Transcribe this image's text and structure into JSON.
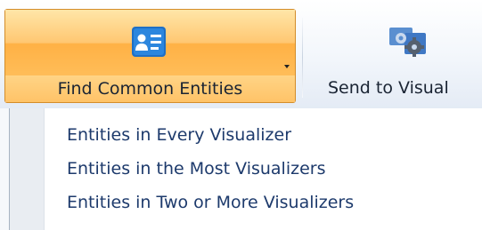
{
  "ribbon": {
    "find_common": {
      "label": "Find Common Entities",
      "icon": "id-card-icon"
    },
    "send_to_visual": {
      "label": "Send to Visual",
      "icon": "gears-icon"
    }
  },
  "menu": {
    "items": [
      {
        "label": "Entities in Every Visualizer"
      },
      {
        "label": "Entities in the Most Visualizers"
      },
      {
        "label": "Entities in Two or More Visualizers"
      }
    ]
  },
  "colors": {
    "active_orange": "#ffc060",
    "icon_blue": "#1f6fc5",
    "menu_text": "#1d3a6c"
  }
}
